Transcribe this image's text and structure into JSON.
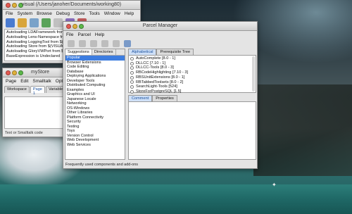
{
  "desktop": {
    "name": "desktop"
  },
  "visual": {
    "title": "visual (/Users/janoher/Documents/working80)",
    "menu": [
      "File",
      "System",
      "Browse",
      "Debug",
      "Store",
      "Tools",
      "Window",
      "Help"
    ],
    "transcript": [
      "Autoloading LDAFramework from $(VISUAL...",
      "Autoloading Lens-Namespace from $(VISUAL...",
      "Autoloading LoggingTool from $(VISUALWOR...",
      "Autoloading Store from $(VISUALWORKS)/...",
      "Autoloading GloryVWPort from $(VISUAL...",
      "BaseExpression is Undeclared"
    ],
    "store_label": "myStore"
  },
  "workspace": {
    "menu": [
      "Page",
      "Edit",
      "Smalltalk",
      "Options"
    ],
    "tabs": [
      "Workspace",
      "Page 1",
      "Variables"
    ],
    "status": "Text or Smalltalk code"
  },
  "parcel_manager": {
    "title": "Parcel Manager",
    "menu": [
      "File",
      "Parcel",
      "Help"
    ],
    "left_tabs": [
      "Suggestions",
      "Directories"
    ],
    "categories": [
      "Popular",
      "Browser Extensions",
      "Code Editing",
      "Database",
      "Deploying Applications",
      "Developer Tools",
      "Distributed Computing",
      "Examples",
      "Graphics and UI",
      "Japanese Locale",
      "Networking",
      "OS-Windows",
      "Other Libraries",
      "Platform Connectivity",
      "Security",
      "Testing",
      "Toys",
      "Version Control",
      "Web Development",
      "Web Services"
    ],
    "right_tabs": [
      "Alphabetical",
      "Prerequisite Tree"
    ],
    "packages": [
      "AutoComplete [8.0 - 1]",
      "DLLCC [7.10 - 1]",
      "DLLCC-Tools [8.0 - 3]",
      "RBCodeHighlighting [7.10 - 3]",
      "RBSUnitExtensions [8.0 - 1]",
      "RBTabbedToolsets [8.0 - 2]",
      "SearchLight-Tools [524]",
      "StoreForPostgreSQL [1.5]"
    ],
    "comment_tabs": [
      "Comment",
      "Properties"
    ],
    "status": "Frequently used components and add-ons"
  },
  "colors": {
    "selection": "#3d7de0",
    "water": "#1f6866"
  }
}
